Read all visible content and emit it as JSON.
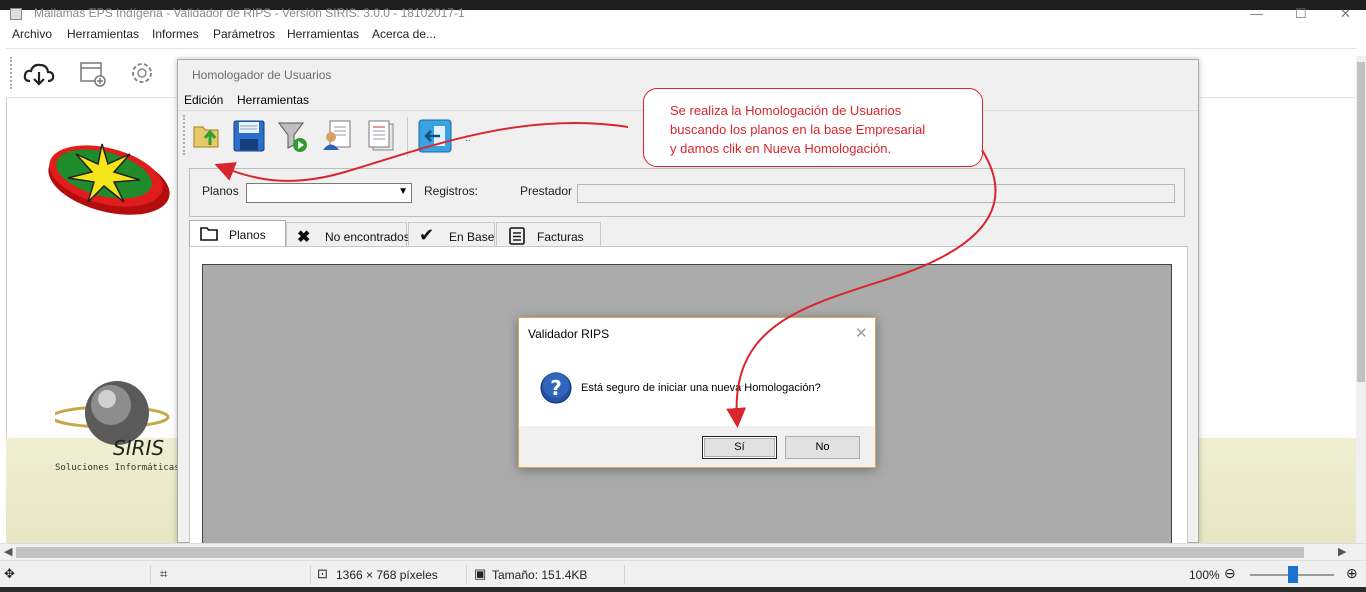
{
  "app": {
    "title": "Mallamas EPS Indígena - Validador de RIPS - Versión SIRIS: 3.0.0 - 18102017-1",
    "minimize": "—",
    "maximize": "☐",
    "close": "✕"
  },
  "menu": [
    "Archivo",
    "Herramientas",
    "Informes",
    "Parámetros",
    "Herramientas",
    "Acerca de..."
  ],
  "logos": {
    "siris_caption": "Soluciones Informáticas",
    "siris_text": "SIRIS"
  },
  "child": {
    "title": "Homologador de Usuarios",
    "menu": [
      "Edición",
      "Herramientas"
    ],
    "filters": {
      "planos_label": "Planos",
      "planos_value": "",
      "registros_label": "Registros:",
      "prestador_label": "Prestador",
      "prestador_value": ""
    },
    "tabs": [
      "Planos",
      "No encontrados",
      "En Base",
      "Facturas"
    ],
    "toolbar_dots": "::"
  },
  "dialog": {
    "title": "Validador RIPS",
    "close": "✕",
    "message": "Está seguro de iniciar una nueva Homologación?",
    "yes_label": "Sí",
    "no_label": "No"
  },
  "annotation": {
    "lines": [
      "Se realiza la Homologación de Usuarios",
      "buscando los planos en la base Empresarial",
      "y damos clik en Nueva Homologación."
    ],
    "color": "#d8262c"
  },
  "statusbar": {
    "dimensions": "1366 × 768 píxeles",
    "size": "Tamaño: 151.4KB",
    "zoom": "100%"
  },
  "colors": {
    "accent": "#1a73d1",
    "annotation": "#d8262c",
    "dialog_border": "#e0a458"
  }
}
